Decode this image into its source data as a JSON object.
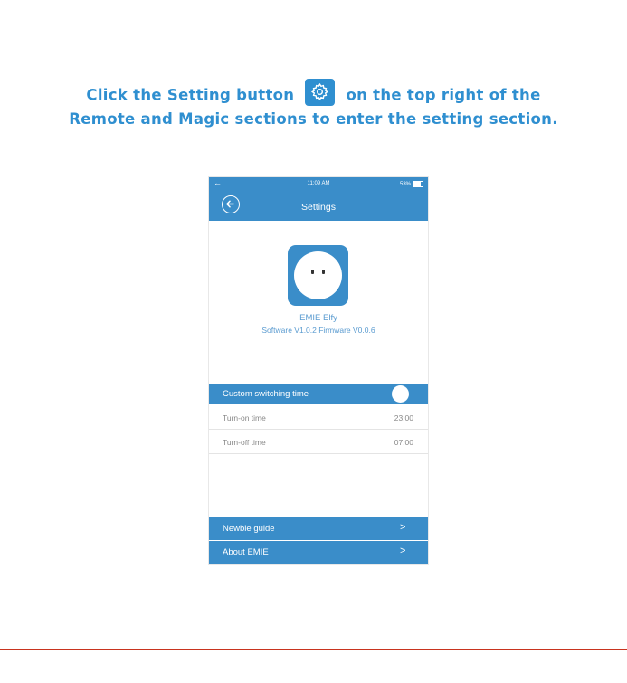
{
  "instruction": {
    "line1_before": "Click the Setting button",
    "line1_after": "on the top right of the",
    "line2": "Remote and Magic sections to enter the setting section.",
    "color": "#2f8fd0"
  },
  "status_bar": {
    "time": "11:09 AM",
    "battery": "53%"
  },
  "header": {
    "title": "Settings",
    "back_icon": "back-circle-arrow-icon"
  },
  "device": {
    "name": "EMIE Elfy",
    "version": "Software V1.0.2 Firmware V0.0.6"
  },
  "custom_switching": {
    "label": "Custom switching time",
    "toggle_on": true
  },
  "timer_rows": [
    {
      "label": "Turn-on time",
      "value": "23:00"
    },
    {
      "label": "Turn-off time",
      "value": "07:00"
    }
  ],
  "menu": [
    {
      "label": "Newbie guide",
      "chevron": ">"
    },
    {
      "label": "About EMIE",
      "chevron": ">"
    }
  ],
  "colors": {
    "accent": "#3a8dc9",
    "rule": "#c8341f"
  }
}
